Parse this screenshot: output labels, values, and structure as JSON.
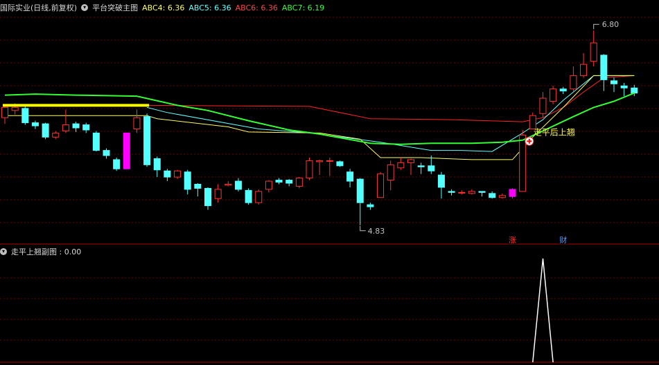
{
  "header_main": {
    "title": "国际实业(日线,前复权)",
    "indicator": "平台突破主图",
    "items": [
      {
        "label": "ABC4: 6.36",
        "color": "#ffff66"
      },
      {
        "label": "ABC5: 6.36",
        "color": "#66ffff"
      },
      {
        "label": "ABC6: 6.36",
        "color": "#ff4444"
      },
      {
        "label": "ABC7: 6.19",
        "color": "#33ff33"
      }
    ]
  },
  "header_sub": {
    "title": "走平上翘副图 : 0.00"
  },
  "colors": {
    "up": "#ff3333",
    "down": "#54ffff",
    "big": "#ff00ff",
    "abc4": "#ffff66",
    "abc5": "#66ffff",
    "abc6": "#ff2222",
    "abc7": "#33ff33",
    "grid": "#6a0000",
    "border": "#b00000",
    "label": "#c0c0c0",
    "signal": "#ffffff"
  },
  "chart_data": [
    {
      "type": "candlestick",
      "ylim": [
        4.75,
        6.95
      ],
      "annotations": {
        "high": {
          "label": "6.80",
          "index": 58
        },
        "low": {
          "label": "4.83",
          "index": 35
        },
        "signal_text": "走平后上翘",
        "signal_index": 52,
        "badges": [
          {
            "label": "涨",
            "index": 50,
            "color": "#ff3333"
          },
          {
            "label": "财",
            "index": 55,
            "color": "#5599ff"
          }
        ]
      },
      "candles": [
        [
          5.95,
          6.05,
          6.07,
          5.89
        ],
        [
          6.02,
          6.05,
          6.09,
          5.98
        ],
        [
          6.04,
          5.9,
          6.06,
          5.88
        ],
        [
          5.9,
          5.87,
          5.92,
          5.84
        ],
        [
          5.89,
          5.76,
          5.9,
          5.74
        ],
        [
          5.76,
          5.8,
          5.82,
          5.74
        ],
        [
          5.82,
          5.88,
          6.03,
          5.8
        ],
        [
          5.89,
          5.85,
          5.91,
          5.81
        ],
        [
          5.88,
          5.83,
          5.9,
          5.8
        ],
        [
          5.8,
          5.63,
          5.82,
          5.62
        ],
        [
          5.63,
          5.58,
          5.65,
          5.55
        ],
        [
          5.54,
          5.45,
          5.56,
          5.43
        ],
        [
          5.45,
          5.8,
          5.8,
          5.45
        ],
        [
          5.84,
          5.95,
          6.03,
          5.8
        ],
        [
          5.96,
          5.49,
          5.99,
          5.47
        ],
        [
          5.55,
          5.44,
          5.57,
          5.37
        ],
        [
          5.43,
          5.37,
          5.45,
          5.33
        ],
        [
          5.37,
          5.43,
          5.44,
          5.35
        ],
        [
          5.42,
          5.25,
          5.44,
          5.2
        ],
        [
          5.3,
          5.26,
          5.31,
          5.18
        ],
        [
          5.26,
          5.09,
          5.27,
          5.05
        ],
        [
          5.16,
          5.25,
          5.3,
          5.12
        ],
        [
          5.29,
          5.3,
          5.33,
          5.28
        ],
        [
          5.33,
          5.25,
          5.36,
          5.23
        ],
        [
          5.24,
          5.12,
          5.26,
          5.1
        ],
        [
          5.12,
          5.23,
          5.25,
          5.1
        ],
        [
          5.25,
          5.33,
          5.34,
          5.22
        ],
        [
          5.34,
          5.32,
          5.36,
          5.3
        ],
        [
          5.34,
          5.31,
          5.35,
          5.28
        ],
        [
          5.28,
          5.36,
          5.37,
          5.26
        ],
        [
          5.36,
          5.53,
          5.56,
          5.34
        ],
        [
          5.52,
          5.53,
          5.54,
          5.39
        ],
        [
          5.53,
          5.53,
          5.56,
          5.38
        ],
        [
          5.52,
          5.48,
          5.53,
          5.47
        ],
        [
          5.42,
          5.33,
          5.45,
          5.27
        ],
        [
          5.35,
          5.12,
          5.36,
          4.9
        ],
        [
          5.1,
          5.08,
          5.12,
          5.05
        ],
        [
          5.17,
          5.4,
          5.42,
          5.17
        ],
        [
          5.34,
          5.49,
          5.53,
          5.24
        ],
        [
          5.46,
          5.51,
          5.56,
          5.44
        ],
        [
          5.51,
          5.54,
          5.55,
          5.39
        ],
        [
          5.48,
          5.47,
          5.51,
          5.4
        ],
        [
          5.48,
          5.43,
          5.58,
          5.4
        ],
        [
          5.39,
          5.27,
          5.42,
          5.16
        ],
        [
          5.23,
          5.22,
          5.25,
          5.19
        ],
        [
          5.22,
          5.22,
          5.24,
          5.2
        ],
        [
          5.21,
          5.23,
          5.25,
          5.2
        ],
        [
          5.23,
          5.22,
          5.23,
          5.18
        ],
        [
          5.21,
          5.17,
          5.23,
          5.16
        ],
        [
          5.17,
          5.19,
          5.21,
          5.16
        ],
        [
          5.18,
          5.25,
          5.26,
          5.16
        ],
        [
          5.23,
          5.78,
          5.83,
          5.23
        ],
        [
          5.84,
          5.97,
          6.0,
          5.84
        ],
        [
          5.99,
          6.14,
          6.2,
          5.95
        ],
        [
          6.11,
          6.23,
          6.26,
          6.08
        ],
        [
          6.23,
          6.21,
          6.25,
          6.18
        ],
        [
          6.23,
          6.36,
          6.45,
          6.2
        ],
        [
          6.36,
          6.47,
          6.58,
          6.34
        ],
        [
          6.5,
          6.68,
          6.8,
          6.45
        ],
        [
          6.56,
          6.32,
          6.57,
          6.21
        ],
        [
          6.31,
          6.28,
          6.34,
          6.2
        ],
        [
          6.26,
          6.24,
          6.29,
          6.16
        ],
        [
          6.24,
          6.19,
          6.27,
          6.16
        ]
      ],
      "big_candles": [
        12,
        50
      ],
      "abc4": [
        [
          0,
          5.97
        ],
        [
          14,
          5.97
        ],
        [
          15,
          5.94
        ],
        [
          22,
          5.86
        ],
        [
          24,
          5.81
        ],
        [
          31,
          5.8
        ],
        [
          35,
          5.74
        ],
        [
          37,
          5.56
        ],
        [
          41,
          5.56
        ],
        [
          46,
          5.54
        ],
        [
          50,
          5.54
        ],
        [
          52,
          5.76
        ],
        [
          55,
          6.05
        ],
        [
          58,
          6.36
        ],
        [
          62,
          6.36
        ]
      ],
      "abc5": [
        [
          14,
          6.05
        ],
        [
          16,
          6.0
        ],
        [
          25,
          5.84
        ],
        [
          30,
          5.8
        ],
        [
          37,
          5.71
        ],
        [
          42,
          5.63
        ],
        [
          45,
          5.63
        ],
        [
          48,
          5.62
        ],
        [
          51,
          5.8
        ],
        [
          53,
          5.93
        ],
        [
          55,
          6.12
        ],
        [
          58,
          6.36
        ],
        [
          62,
          6.36
        ]
      ],
      "abc6": [
        [
          14,
          6.07
        ],
        [
          30,
          6.06
        ],
        [
          36,
          5.94
        ],
        [
          44,
          5.93
        ],
        [
          51,
          5.91
        ],
        [
          53,
          5.95
        ],
        [
          55,
          6.05
        ],
        [
          57,
          6.2
        ],
        [
          59,
          6.34
        ],
        [
          62,
          6.36
        ]
      ],
      "abc7": [
        [
          0,
          6.17
        ],
        [
          3,
          6.18
        ],
        [
          7,
          6.17
        ],
        [
          13,
          6.16
        ],
        [
          17,
          6.07
        ],
        [
          20,
          6.02
        ],
        [
          24,
          5.92
        ],
        [
          28,
          5.83
        ],
        [
          31,
          5.79
        ],
        [
          36,
          5.7
        ],
        [
          39,
          5.69
        ],
        [
          42,
          5.7
        ],
        [
          46,
          5.7
        ],
        [
          49,
          5.71
        ],
        [
          51,
          5.73
        ],
        [
          53,
          5.82
        ],
        [
          56,
          5.96
        ],
        [
          58,
          6.05
        ],
        [
          60,
          6.11
        ],
        [
          62,
          6.19
        ]
      ],
      "platform_line": [
        [
          0,
          6.07
        ],
        [
          14,
          6.07
        ]
      ]
    },
    {
      "type": "line",
      "ylim": [
        0,
        1
      ],
      "signal": [
        [
          52,
          0
        ],
        [
          53,
          1
        ],
        [
          54,
          0
        ]
      ]
    }
  ]
}
